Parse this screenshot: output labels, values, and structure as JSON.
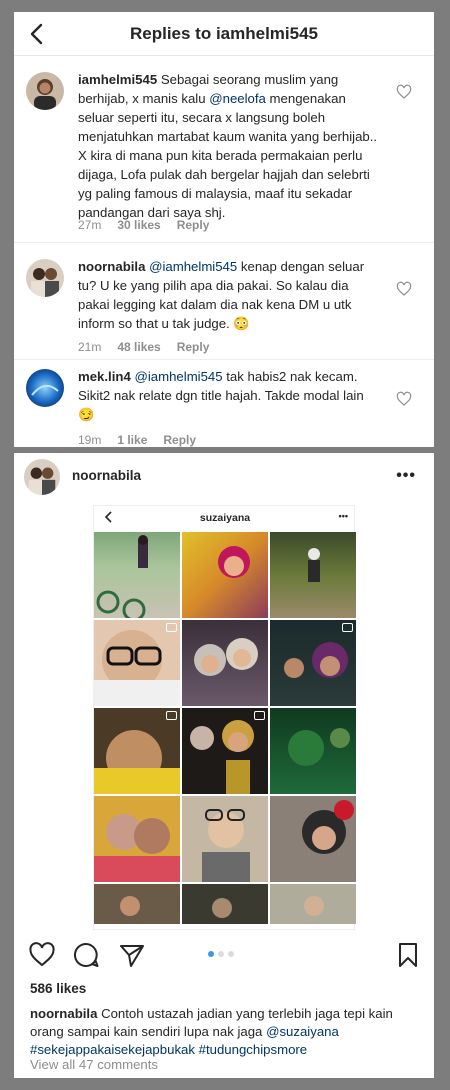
{
  "replies_header": {
    "title": "Replies to iamhelmi545"
  },
  "comments": [
    {
      "username": "iamhelmi545",
      "text_before": " Sebagai seorang muslim yang berhijab, x manis kalu ",
      "mention": "@neelofa",
      "text_after": " mengenakan seluar seperti itu, secara x langsung boleh menjatuhkan martabat kaum wanita yang berhijab.. X kira di mana pun kita berada permakaian perlu dijaga, Lofa pulak dah bergelar hajjah dan selebrti yg paling famous di malaysia, maaf itu sekadar pandangan dari saya shj.",
      "time": "27m",
      "likes": "30 likes",
      "reply": "Reply"
    },
    {
      "username": "noornabila",
      "text_before": " ",
      "mention": "@iamhelmi545",
      "text_after": " kenap dengan seluar tu? U ke yang pilih apa dia pakai. So kalau dia pakai legging kat dalam dia nak kena DM u utk inform so that u tak judge. 😳",
      "time": "21m",
      "likes": "48 likes",
      "reply": "Reply"
    },
    {
      "username": "mek.lin4",
      "text_before": " ",
      "mention": "@iamhelmi545",
      "text_after": " tak habis2 nak kecam. Sikit2 nak relate dgn title hajah. Takde modal lain 😏",
      "time": "19m",
      "likes": "1 like",
      "reply": "Reply"
    }
  ],
  "post": {
    "username": "noornabila",
    "more": "•••",
    "embedded": {
      "title": "suzaiyana",
      "more": "•••"
    },
    "likes": "586 likes",
    "caption_user": "noornabila",
    "caption_text": " Contoh ustazah jadian yang terlebih jaga tepi kain orang sampai kain sendiri lupa nak jaga ",
    "caption_mention": "@suzaiyana",
    "caption_tags": "#sekejappakaisekejapbukak #tudungchipsmore",
    "view_all": "View all 47 comments"
  },
  "icons": {
    "back": "chevron-left-icon",
    "heart": "heart-icon",
    "comment": "comment-bubble-icon",
    "share": "paper-plane-icon",
    "save": "bookmark-icon",
    "more": "more-dots-icon"
  },
  "colors": {
    "text": "#262626",
    "muted": "#8e8e8e",
    "mention": "#003569",
    "accent_dot": "#3897f0",
    "background": "#7d7d7d"
  }
}
